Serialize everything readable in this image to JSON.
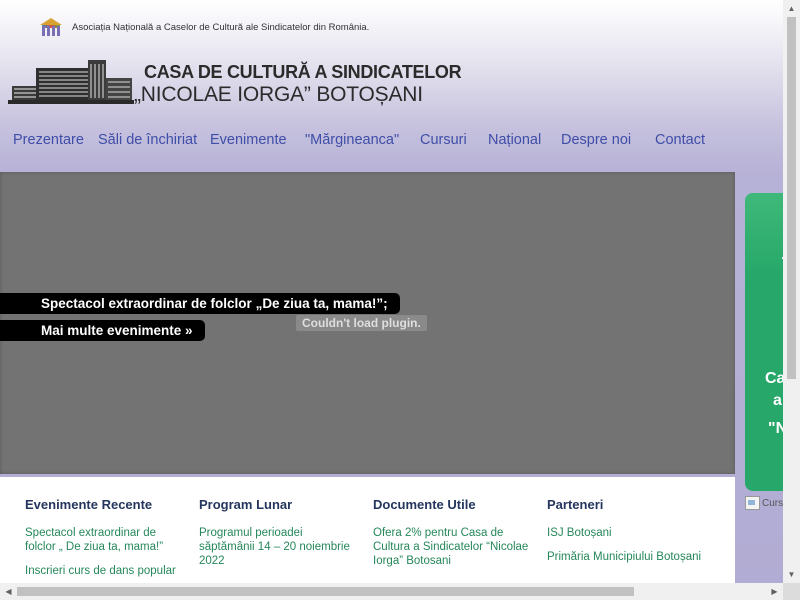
{
  "header": {
    "association": "Asociația Națională a Caselor de Cultură ale Sindicatelor din România.",
    "brand_line1": "CASA DE CULTURĂ A SINDICATELOR",
    "brand_line2": "„NICOLAE IORGA” BOTOȘANI"
  },
  "nav": [
    "Prezentare",
    "Săli de închiriat",
    "Evenimente",
    "\"Mărgineanca\"",
    "Cursuri",
    "Național",
    "Despre noi",
    "Contact"
  ],
  "hero": {
    "event_title": "Spectacol extraordinar de folclor „De ziua ta, mama!”;",
    "more_events": "Mai multe evenimente »",
    "plugin_message": "Couldn't load plugin."
  },
  "promo": {
    "line1": "Ca",
    "line2": "a",
    "line3": "\"N",
    "image_alt": "Curs"
  },
  "columns": [
    {
      "title": "Evenimente Recente",
      "links": [
        "Spectacol extraordinar de folclor „ De ziua ta, mama!”",
        "Inscrieri curs de dans popular"
      ]
    },
    {
      "title": "Program Lunar",
      "links": [
        "Programul perioadei săptămânii 14 – 20 noiembrie 2022"
      ]
    },
    {
      "title": "Documente Utile",
      "links": [
        "Ofera 2% pentru Casa de Cultura a Sindicatelor “Nicolae Iorga” Botosani"
      ]
    },
    {
      "title": "Parteneri",
      "links": [
        "ISJ Botoșani",
        "Primăria Municipiului Botoșani"
      ]
    }
  ],
  "colors": {
    "nav_link": "#3f4ea8",
    "content_link": "#25875a",
    "heading": "#25365e",
    "hero_bg": "#737373",
    "promo_green": "#27a86a"
  }
}
